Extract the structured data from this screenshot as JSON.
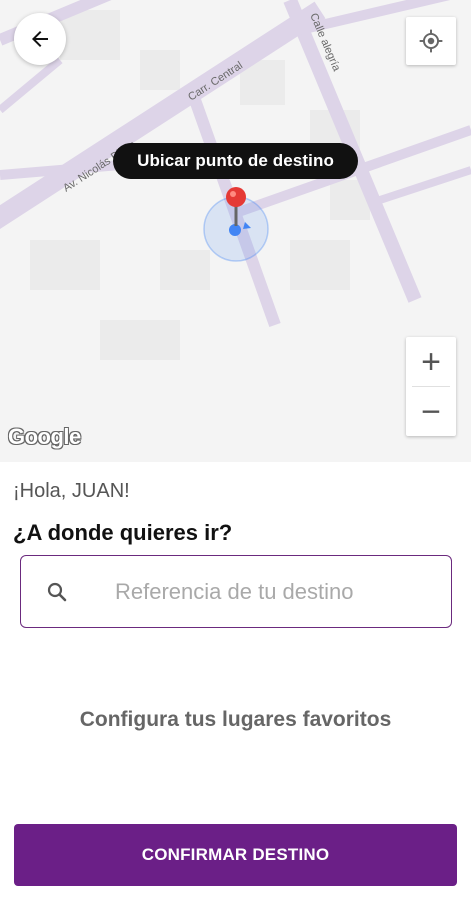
{
  "map": {
    "streets": {
      "main_avenue": "Av. Nicolás Billón",
      "carr_central": "Carr. Central",
      "calle_alegria": "Calle alegría"
    },
    "pin_tooltip": "Ubicar punto de destino",
    "zoom_in_label": "+",
    "zoom_out_label": "−",
    "attribution": "Google",
    "icons": {
      "back": "arrow-left-icon",
      "locate": "my-location-icon",
      "pin": "map-pin-icon",
      "current_location": "current-location-dot-icon"
    }
  },
  "sheet": {
    "greeting": "¡Hola, JUAN!",
    "question": "¿A donde quieres ir?",
    "search": {
      "placeholder": "Referencia de tu destino",
      "value": ""
    },
    "favorites_link": "Configura tus lugares favoritos",
    "confirm_button": "CONFIRMAR DESTINO"
  },
  "colors": {
    "primary": "#6b1f87",
    "tooltip_bg": "#111111",
    "pin_red": "#e53935",
    "location_blue": "#4285f4",
    "street_purple": "#ddd4e8"
  }
}
